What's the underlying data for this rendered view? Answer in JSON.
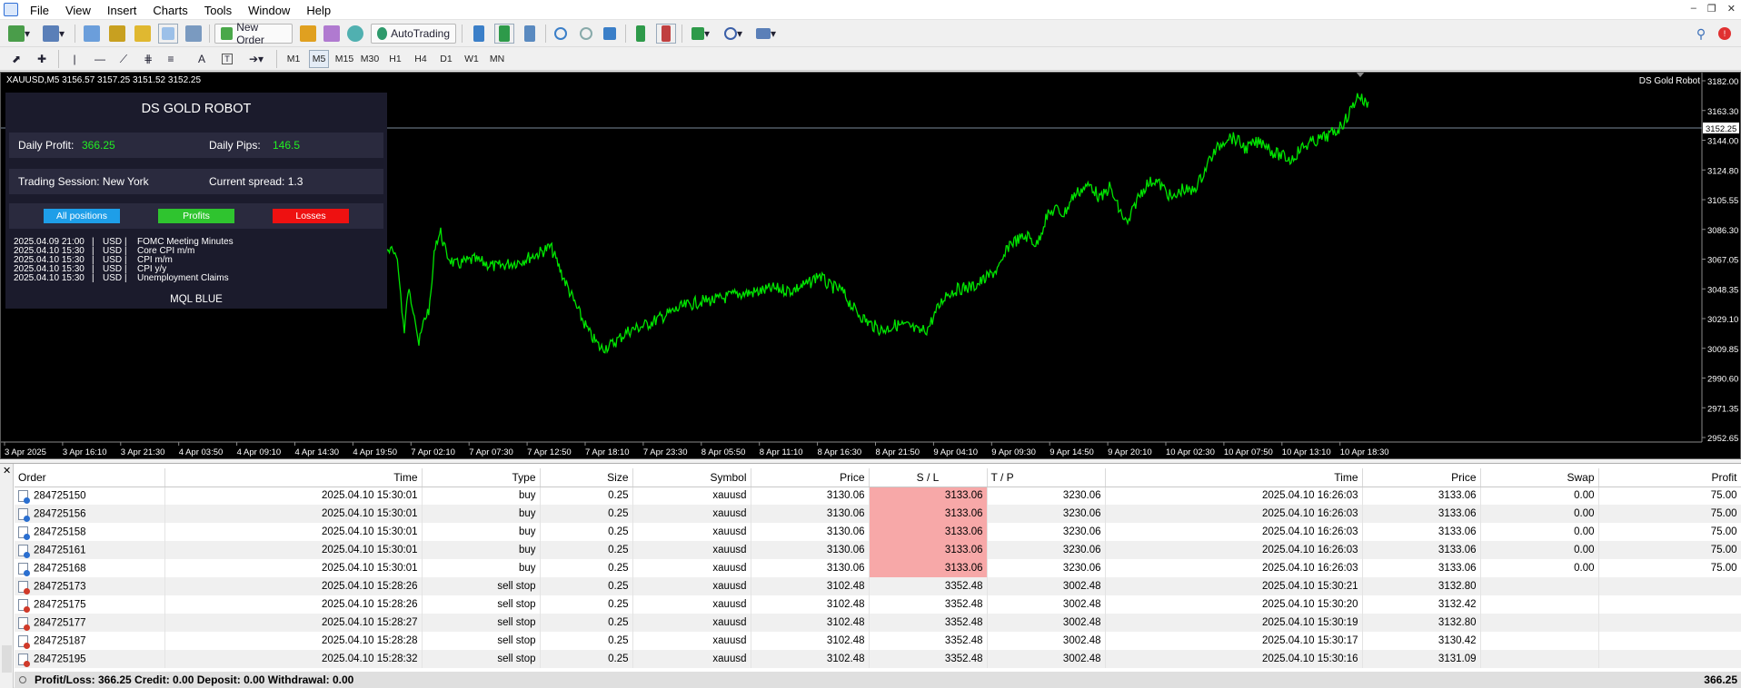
{
  "menu": [
    "File",
    "View",
    "Insert",
    "Charts",
    "Tools",
    "Window",
    "Help"
  ],
  "toolbar": {
    "new_order": "New Order",
    "auto_trading": "AutoTrading"
  },
  "timeframes": [
    "M1",
    "M5",
    "M15",
    "M30",
    "H1",
    "H4",
    "D1",
    "W1",
    "MN"
  ],
  "chart": {
    "symbol_line": "XAUUSD,M5  3156.57 3157.25 3151.52 3152.25",
    "expert": "DS Gold Robot",
    "current_price": "3152.25",
    "price_labels": [
      "3182.00",
      "3163.30",
      "3144.00",
      "3124.80",
      "3105.55",
      "3086.30",
      "3067.05",
      "3048.35",
      "3029.10",
      "3009.85",
      "2990.60",
      "2971.35",
      "2952.65"
    ],
    "time_labels": [
      "3 Apr 2025",
      "3 Apr 16:10",
      "3 Apr 21:30",
      "4 Apr 03:50",
      "4 Apr 09:10",
      "4 Apr 14:30",
      "4 Apr 19:50",
      "7 Apr 02:10",
      "7 Apr 07:30",
      "7 Apr 12:50",
      "7 Apr 18:10",
      "7 Apr 23:30",
      "8 Apr 05:50",
      "8 Apr 11:10",
      "8 Apr 16:30",
      "8 Apr 21:50",
      "9 Apr 04:10",
      "9 Apr 09:30",
      "9 Apr 14:50",
      "9 Apr 20:10",
      "10 Apr 02:30",
      "10 Apr 07:50",
      "10 Apr 13:10",
      "10 Apr 18:30"
    ],
    "line_color": "#00e400"
  },
  "panel": {
    "title": "DS GOLD ROBOT",
    "daily_profit_label": "Daily Profit:",
    "daily_profit": "366.25",
    "daily_pips_label": "Daily Pips:",
    "daily_pips": "146.5",
    "session_label": "Trading Session: New York",
    "spread_label": "Current spread: 1.3",
    "btn_all": "All positions",
    "btn_profits": "Profits",
    "btn_losses": "Losses",
    "news": [
      {
        "time": "2025.04.09 21:00",
        "cur": "USD",
        "event": "FOMC Meeting Minutes"
      },
      {
        "time": "2025.04.10 15:30",
        "cur": "USD",
        "event": "Core CPI m/m"
      },
      {
        "time": "2025.04.10 15:30",
        "cur": "USD",
        "event": "CPI m/m"
      },
      {
        "time": "2025.04.10 15:30",
        "cur": "USD",
        "event": "CPI y/y"
      },
      {
        "time": "2025.04.10 15:30",
        "cur": "USD",
        "event": "Unemployment Claims"
      }
    ],
    "footer": "MQL BLUE"
  },
  "table": {
    "headers": [
      "Order",
      "Time",
      "Type",
      "Size",
      "Symbol",
      "Price",
      "S / L",
      "T / P",
      "Time",
      "Price",
      "Swap",
      "Profit"
    ],
    "rows": [
      [
        "284725150",
        "2025.04.10 15:30:01",
        "buy",
        "0.25",
        "xauusd",
        "3130.06",
        "3133.06",
        "3230.06",
        "2025.04.10 16:26:03",
        "3133.06",
        "0.00",
        "75.00"
      ],
      [
        "284725156",
        "2025.04.10 15:30:01",
        "buy",
        "0.25",
        "xauusd",
        "3130.06",
        "3133.06",
        "3230.06",
        "2025.04.10 16:26:03",
        "3133.06",
        "0.00",
        "75.00"
      ],
      [
        "284725158",
        "2025.04.10 15:30:01",
        "buy",
        "0.25",
        "xauusd",
        "3130.06",
        "3133.06",
        "3230.06",
        "2025.04.10 16:26:03",
        "3133.06",
        "0.00",
        "75.00"
      ],
      [
        "284725161",
        "2025.04.10 15:30:01",
        "buy",
        "0.25",
        "xauusd",
        "3130.06",
        "3133.06",
        "3230.06",
        "2025.04.10 16:26:03",
        "3133.06",
        "0.00",
        "75.00"
      ],
      [
        "284725168",
        "2025.04.10 15:30:01",
        "buy",
        "0.25",
        "xauusd",
        "3130.06",
        "3133.06",
        "3230.06",
        "2025.04.10 16:26:03",
        "3133.06",
        "0.00",
        "75.00"
      ],
      [
        "284725173",
        "2025.04.10 15:28:26",
        "sell stop",
        "0.25",
        "xauusd",
        "3102.48",
        "3352.48",
        "3002.48",
        "2025.04.10 15:30:21",
        "3132.80",
        "",
        ""
      ],
      [
        "284725175",
        "2025.04.10 15:28:26",
        "sell stop",
        "0.25",
        "xauusd",
        "3102.48",
        "3352.48",
        "3002.48",
        "2025.04.10 15:30:20",
        "3132.42",
        "",
        ""
      ],
      [
        "284725177",
        "2025.04.10 15:28:27",
        "sell stop",
        "0.25",
        "xauusd",
        "3102.48",
        "3352.48",
        "3002.48",
        "2025.04.10 15:30:19",
        "3132.80",
        "",
        ""
      ],
      [
        "284725187",
        "2025.04.10 15:28:28",
        "sell stop",
        "0.25",
        "xauusd",
        "3102.48",
        "3352.48",
        "3002.48",
        "2025.04.10 15:30:17",
        "3130.42",
        "",
        ""
      ],
      [
        "284725195",
        "2025.04.10 15:28:32",
        "sell stop",
        "0.25",
        "xauusd",
        "3102.48",
        "3352.48",
        "3002.48",
        "2025.04.10 15:30:16",
        "3131.09",
        "",
        ""
      ]
    ]
  },
  "footer": {
    "summary": "Profit/Loss: 366.25   Credit: 0.00   Deposit: 0.00   Withdrawal: 0.00",
    "total": "366.25"
  }
}
